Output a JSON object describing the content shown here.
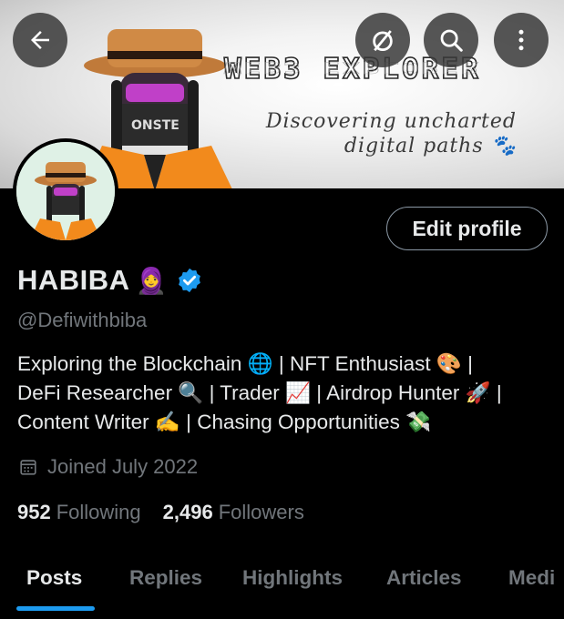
{
  "banner": {
    "title": "WEB3 EXPLORER",
    "tagline_line1": "Discovering uncharted",
    "tagline_line2": "digital paths 🐾"
  },
  "header_icons": [
    "back-arrow-icon",
    "hide-icon",
    "search-icon",
    "more-icon"
  ],
  "profile": {
    "edit_label": "Edit profile",
    "name": "HABIBA",
    "name_emoji": "🧕",
    "handle": "@Defiwithbiba",
    "bio": [
      "Exploring the Blockchain 🌐 | NFT Enthusiast 🎨 |",
      "DeFi Researcher 🔍 | Trader 📈 | Airdrop Hunter 🚀 |",
      "Content Writer ✍️ | Chasing Opportunities 💸"
    ],
    "joined": "Joined July 2022",
    "following_count": "952",
    "following_label": "Following",
    "followers_count": "2,496",
    "followers_label": "Followers"
  },
  "tabs": [
    {
      "label": "Posts",
      "active": true
    },
    {
      "label": "Replies"
    },
    {
      "label": "Highlights"
    },
    {
      "label": "Articles"
    },
    {
      "label": "Medi"
    }
  ],
  "colors": {
    "accent": "#1d9bf0",
    "muted": "#71767b",
    "text": "#e7e9ea",
    "background": "#000000"
  }
}
